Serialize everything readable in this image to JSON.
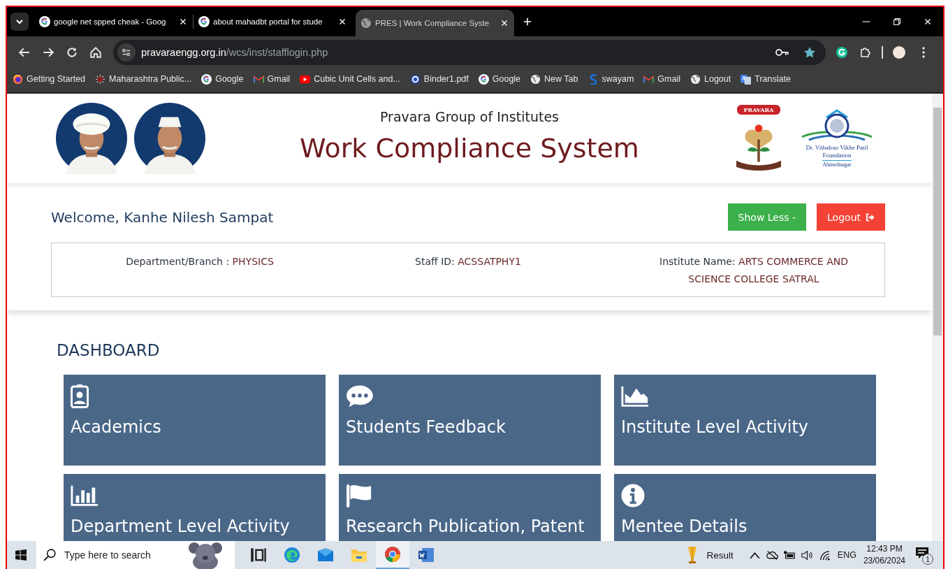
{
  "browser": {
    "tabs": [
      {
        "title": "google net spped cheak - Goog",
        "kind": "google",
        "selected": false
      },
      {
        "title": "about mahadbt portal for stude",
        "kind": "google",
        "selected": false
      },
      {
        "title": "PRES | Work Compliance Syste",
        "kind": "globe",
        "selected": true
      }
    ],
    "address": {
      "host": "pravaraengg.org.in",
      "path": "/wcs/inst/stafflogin.php"
    },
    "bookmarks": [
      {
        "label": "Getting Started",
        "kind": "firefox"
      },
      {
        "label": "Maharashtra Public...",
        "kind": "emblem"
      },
      {
        "label": "Google",
        "kind": "google"
      },
      {
        "label": "Gmail",
        "kind": "gmail"
      },
      {
        "label": "Cubic Unit Cells and...",
        "kind": "youtube"
      },
      {
        "label": "Binder1.pdf",
        "kind": "seal"
      },
      {
        "label": "Google",
        "kind": "google"
      },
      {
        "label": "New Tab",
        "kind": "globe"
      },
      {
        "label": "swayam",
        "kind": "swayam"
      },
      {
        "label": "Gmail",
        "kind": "gmail"
      },
      {
        "label": "Logout",
        "kind": "globe"
      },
      {
        "label": "Translate",
        "kind": "translate"
      }
    ]
  },
  "header": {
    "org": "Pravara Group of Institutes",
    "title": "Work Compliance System",
    "logo_text": "PRAVARA",
    "foundation": {
      "name": "Dr. Vithalrao Vikhe Patil Foundation",
      "place": "Ahmednagar"
    }
  },
  "welcome": {
    "text": "Welcome, Kanhe Nilesh Sampat",
    "buttons": [
      {
        "label": "Show Less -",
        "kind": "toggle"
      },
      {
        "label": "Logout",
        "kind": "logout"
      }
    ]
  },
  "info": [
    {
      "label": "Department/Branch :",
      "value": "PHYSICS"
    },
    {
      "label": "Staff ID:",
      "value": "ACSSATPHY1"
    },
    {
      "label": "Institute Name:",
      "value": "ARTS COMMERCE AND SCIENCE COLLEGE SATRAL"
    }
  ],
  "dashboard": {
    "heading": "DASHBOARD",
    "cards": [
      {
        "title": "Academics",
        "kind": "badge"
      },
      {
        "title": "Students Feedback",
        "kind": "comment"
      },
      {
        "title": "Institute Level Activity",
        "kind": "area"
      },
      {
        "title": "Department Level Activity",
        "kind": "bars"
      },
      {
        "title": "Research Publication, Patent",
        "kind": "flag"
      },
      {
        "title": "Mentee Details",
        "kind": "info"
      }
    ]
  },
  "taskbar": {
    "search": {
      "placeholder": "Type here to search"
    },
    "apps": [
      {
        "kind": "taskview",
        "selected": false
      },
      {
        "kind": "edge",
        "selected": false
      },
      {
        "kind": "mail",
        "selected": false
      },
      {
        "kind": "folder",
        "selected": false
      },
      {
        "kind": "chrome",
        "selected": true
      },
      {
        "kind": "word",
        "selected": false
      }
    ],
    "weather": "Result",
    "language": "ENG",
    "time": "12:43 PM",
    "date": "23/06/2024",
    "notifications": "1"
  }
}
